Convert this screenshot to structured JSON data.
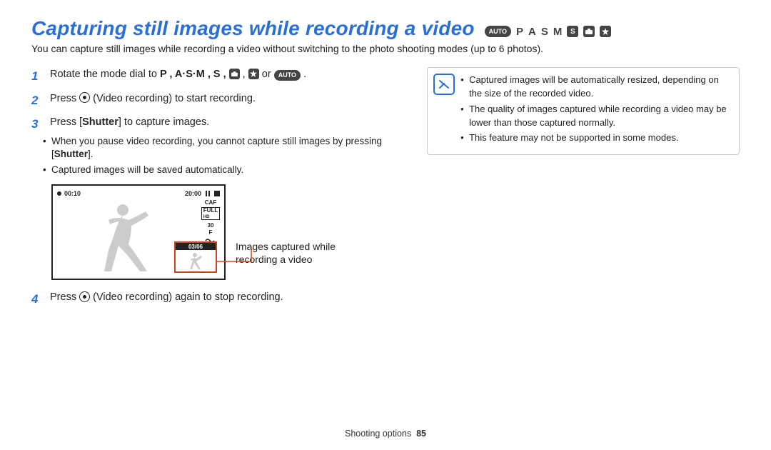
{
  "title": "Capturing still images while recording a video",
  "title_modes": {
    "auto_label": "AUTO",
    "letters": [
      "P",
      "A",
      "S",
      "M"
    ],
    "s_badge": "S"
  },
  "intro": "You can capture still images while recording a video without switching to the photo shooting modes (up to 6 photos).",
  "steps": {
    "s1": {
      "prefix": "Rotate the mode dial to ",
      "tokens": "P ,  A·S·M ,  S ,  ",
      "or": " or ",
      "auto": "AUTO",
      "suffix": " ."
    },
    "s2": {
      "pre": "Press ",
      "post": " (Video recording) to start recording."
    },
    "s3": {
      "pre": "Press [",
      "bold": "Shutter",
      "post": "] to capture images.",
      "b1a": "When you pause video recording, you cannot capture still images by pressing ",
      "b1b": "[",
      "b1bold": "Shutter",
      "b1c": "].",
      "b2": "Captured images will be saved automatically."
    },
    "s4": {
      "pre": "Press ",
      "post": " (Video recording) again to stop recording."
    }
  },
  "diagram": {
    "rec_time": "00:10",
    "remain_time": "20:00",
    "caf": "CAF",
    "full": "FULL",
    "hd": "HD",
    "thirty": "30",
    "f": "F",
    "thumb_count": "03/06",
    "caption": "Images captured while recording a video"
  },
  "notes": {
    "n1": "Captured images will be automatically resized, depending on the size of the recorded video.",
    "n2": "The quality of images captured while recording a video may be lower than those captured normally.",
    "n3": "This feature may not be supported in some modes."
  },
  "footer": {
    "section": "Shooting options",
    "page": "85"
  }
}
